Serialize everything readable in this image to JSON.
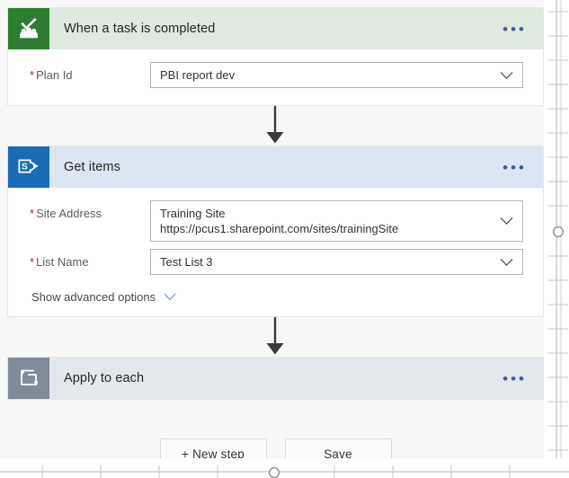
{
  "flow": {
    "steps": [
      {
        "id": "when-a-task-is-completed",
        "title": "When a task is completed",
        "icon": "planner-icon",
        "menu": "•••",
        "fields": [
          {
            "label": "Plan Id",
            "required": "*",
            "value": "PBI report dev",
            "control": "dropdown",
            "chevron": "chevron-down-icon"
          }
        ]
      },
      {
        "id": "get-items",
        "title": "Get items",
        "icon": "sharepoint-icon",
        "menu": "•••",
        "fields": [
          {
            "label": "Site Address",
            "required": "*",
            "value": "Training Site",
            "value_secondary": "https://pcus1.sharepoint.com/sites/trainingSite",
            "control": "dropdown",
            "chevron": "chevron-down-icon"
          },
          {
            "label": "List Name",
            "required": "*",
            "value": "Test List 3",
            "control": "dropdown",
            "chevron": "chevron-down-icon"
          }
        ],
        "advanced_options_label": "Show advanced options"
      },
      {
        "id": "apply-to-each",
        "title": "Apply to each",
        "icon": "loop-icon",
        "menu": "•••",
        "fields": []
      }
    ],
    "connectors": [
      "arrow-down-icon",
      "arrow-down-icon"
    ]
  },
  "actions": {
    "new_step_label": "+ New step",
    "save_label": "Save"
  },
  "colors": {
    "planner_green": "#2f7d32",
    "planner_header": "#dfe9df",
    "sharepoint_blue": "#1a6bb5",
    "sharepoint_header": "#dce6f2",
    "loop_gray": "#7f8b99",
    "loop_header": "#e4e8ed",
    "required_red": "#a4262c",
    "menu_blue": "#3d5a96"
  }
}
